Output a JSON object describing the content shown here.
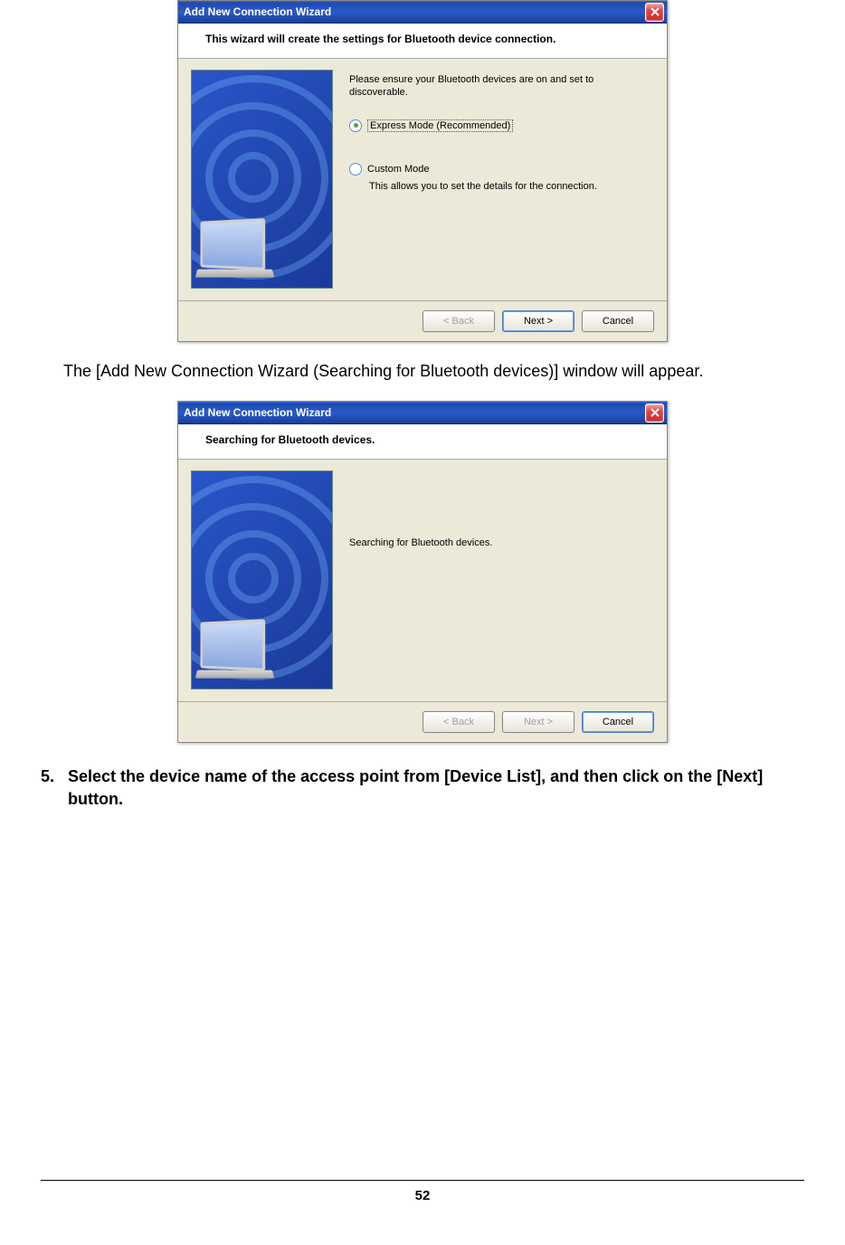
{
  "wizard1": {
    "title": "Add New Connection Wizard",
    "header": "This wizard will create the settings for Bluetooth device connection.",
    "instruction": "Please ensure your Bluetooth devices are on and set to discoverable.",
    "option_express": "Express Mode (Recommended)",
    "option_custom": "Custom Mode",
    "custom_sub": "This allows you to set the details for the connection.",
    "btn_back": "< Back",
    "btn_next": "Next >",
    "btn_cancel": "Cancel"
  },
  "doc_text1": "The [Add New Connection Wizard (Searching for Bluetooth devices)] window will appear.",
  "wizard2": {
    "title": "Add New Connection Wizard",
    "header": "Searching for Bluetooth devices.",
    "status": "Searching for Bluetooth devices.",
    "btn_back": "< Back",
    "btn_next": "Next >",
    "btn_cancel": "Cancel"
  },
  "step5_num": "5.",
  "step5_text": "Select the device name of the access point from [Device List], and then click on the [Next] button.",
  "page_number": "52"
}
